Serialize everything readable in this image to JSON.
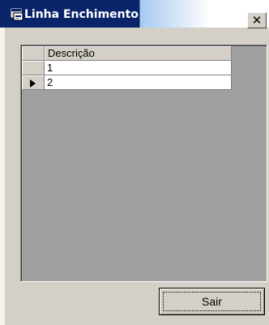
{
  "window": {
    "title": "Linha Enchimento",
    "close_glyph": "✕"
  },
  "icons": {
    "app": "window-app-icon",
    "close": "close-icon",
    "row_pointer": "current-row-pointer-icon"
  },
  "colors": {
    "title_active": "#0a246a",
    "face": "#d4d0c8",
    "grid_background": "#a0a0a0",
    "cell_background": "#ffffff"
  },
  "grid": {
    "columns": [
      {
        "header": "Descrição"
      }
    ],
    "rows": [
      {
        "descricao": "1",
        "current": false
      },
      {
        "descricao": "2",
        "current": true
      }
    ]
  },
  "buttons": {
    "sair": "Sair"
  }
}
